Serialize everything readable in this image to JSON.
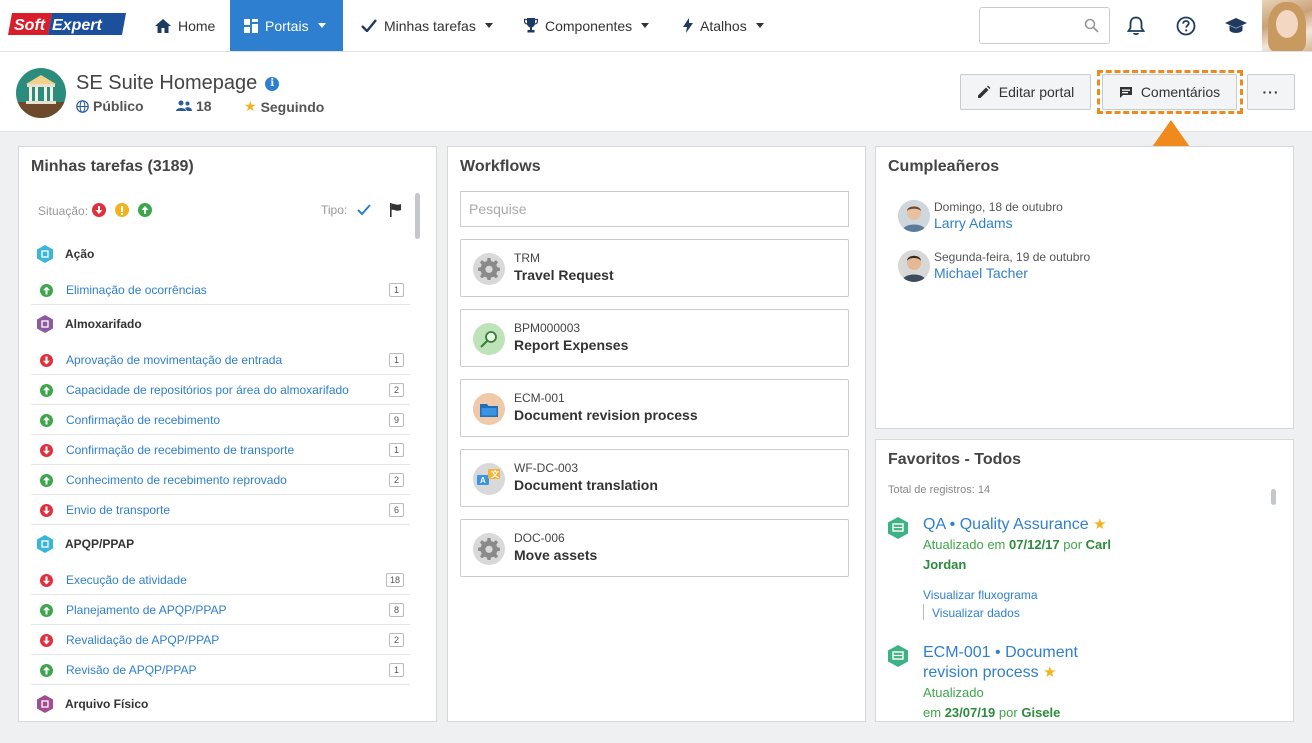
{
  "navbar": {
    "logo_part1": "Soft",
    "logo_part2": "Expert",
    "items": [
      {
        "label": "Home",
        "icon": "home-icon"
      },
      {
        "label": "Portais",
        "icon": "grid-icon",
        "active": true
      },
      {
        "label": "Minhas tarefas",
        "icon": "check-icon"
      },
      {
        "label": "Componentes",
        "icon": "trophy-icon"
      },
      {
        "label": "Atalhos",
        "icon": "bolt-icon"
      }
    ],
    "search_placeholder": ""
  },
  "header": {
    "title": "SE Suite Homepage",
    "visibility": "Público",
    "members": "18",
    "following": "Seguindo",
    "edit_label": "Editar portal",
    "comments_label": "Comentários",
    "more_label": "···"
  },
  "tasks": {
    "title": "Minhas tarefas (3189)",
    "situation_label": "Situação:",
    "type_label": "Tipo:",
    "groups": [
      {
        "name": "Ação",
        "color": "#3bb6d6",
        "items": [
          {
            "label": "Eliminação de ocorrências",
            "count": "1",
            "status": "green"
          }
        ]
      },
      {
        "name": "Almoxarifado",
        "color": "#8e5a9e",
        "items": [
          {
            "label": "Aprovação de movimentação de entrada",
            "count": "1",
            "status": "red"
          },
          {
            "label": "Capacidade de repositórios por área do almoxarifado",
            "count": "2",
            "status": "green"
          },
          {
            "label": "Confirmação de recebimento",
            "count": "9",
            "status": "green"
          },
          {
            "label": "Confirmação de recebimento de transporte",
            "count": "1",
            "status": "red"
          },
          {
            "label": "Conhecimento de recebimento reprovado",
            "count": "2",
            "status": "green"
          },
          {
            "label": "Envio de transporte",
            "count": "6",
            "status": "red"
          }
        ]
      },
      {
        "name": "APQP/PPAP",
        "color": "#3bb6d6",
        "items": [
          {
            "label": "Execução de atividade",
            "count": "18",
            "status": "red"
          },
          {
            "label": "Planejamento de APQP/PPAP",
            "count": "8",
            "status": "green"
          },
          {
            "label": "Revalidação de APQP/PPAP",
            "count": "2",
            "status": "red"
          },
          {
            "label": "Revisão de APQP/PPAP",
            "count": "1",
            "status": "green"
          }
        ]
      },
      {
        "name": "Arquivo Físico",
        "color": "#a24c91",
        "items": []
      }
    ]
  },
  "workflows": {
    "title": "Workflows",
    "search_placeholder": "Pesquise",
    "items": [
      {
        "code": "TRM",
        "name": "Travel Request",
        "icon": "gear-icon",
        "bg": "#d9d9d9"
      },
      {
        "code": "BPM000003",
        "name": "Report Expenses",
        "icon": "magnifier-icon",
        "bg": "#bfe3b9"
      },
      {
        "code": "ECM-001",
        "name": "Document revision process",
        "icon": "folder-icon",
        "bg": "#efc9a8"
      },
      {
        "code": "WF-DC-003",
        "name": "Document translation",
        "icon": "translate-icon",
        "bg": "#d9d9d9"
      },
      {
        "code": "DOC-006",
        "name": "Move assets",
        "icon": "gear-icon",
        "bg": "#d9d9d9"
      }
    ]
  },
  "birthdays": {
    "title": "Cumpleañeros",
    "items": [
      {
        "date": "Domingo, 18 de outubro",
        "name": "Larry Adams"
      },
      {
        "date": "Segunda-feira, 19 de outubro",
        "name": "Michael Tacher"
      }
    ]
  },
  "favorites": {
    "title": "Favoritos - Todos",
    "total": "Total de registros: 14",
    "items": [
      {
        "title": "QA • Quality Assurance",
        "updated_prefix": "Atualizado em",
        "date": "07/12/17",
        "by": "por",
        "author": "Carl Jordan",
        "link1": "Visualizar fluxograma",
        "link2": "Visualizar dados"
      },
      {
        "title": "ECM-001 • Document revision process",
        "updated_prefix": "Atualizado",
        "date_prefix": "em",
        "date": "23/07/19",
        "by": "por",
        "author": "Gisele"
      }
    ]
  }
}
